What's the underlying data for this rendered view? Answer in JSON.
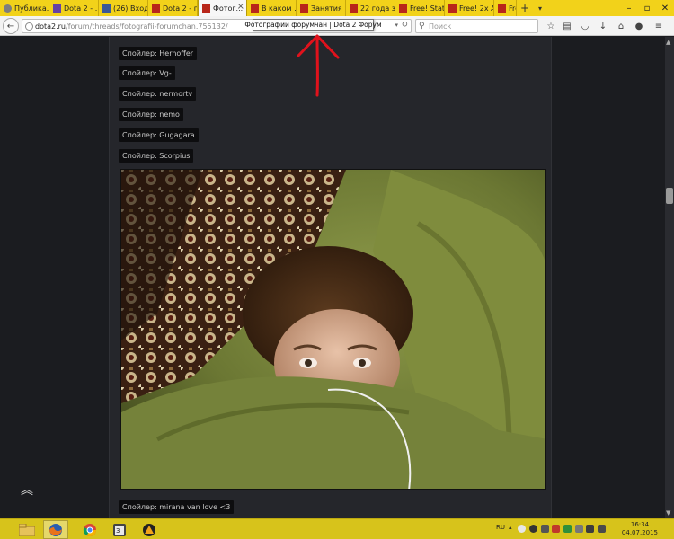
{
  "browser": {
    "tabs": [
      {
        "label": "Публика...",
        "icon": "globe-icon"
      },
      {
        "label": "Dota 2 - ...",
        "icon": "twitch-icon"
      },
      {
        "label": "(26) Вход...",
        "icon": "facebook-icon"
      },
      {
        "label": "Dota 2 - г...",
        "icon": "dota2-icon"
      },
      {
        "label": "Фотог...",
        "icon": "dota2-icon",
        "active": true
      },
      {
        "label": "В каком ...",
        "icon": "dota2-icon"
      },
      {
        "label": "Занятия ...",
        "icon": "dota2-icon"
      },
      {
        "label": "22 года з...",
        "icon": "dota2-icon"
      },
      {
        "label": "Free! Stat...",
        "icon": "dota2-icon"
      },
      {
        "label": "Free! 2x A...",
        "icon": "dota2-icon"
      },
      {
        "label": "Free",
        "icon": "dota2-icon"
      }
    ],
    "url_host": "dota2.ru",
    "url_path": "/forum/threads/fotografii-forumchan.755132/",
    "search_placeholder": "Поиск",
    "tooltip": "Фотографии форумчан | Dota 2 Форум"
  },
  "thread": {
    "spoilers": [
      "Спойлер: Herhoffer",
      "Спойлер: Vg-",
      "Спойлер: nermortv",
      "Спойлер: nemo",
      "Спойлер: Gugagara",
      "Спойлер: Scorpius"
    ],
    "spoiler_after_photo": "Спойлер: mirana van love <3"
  },
  "taskbar": {
    "language": "RU",
    "time": "16:34",
    "date": "04.07.2015"
  },
  "colors": {
    "tab_bar": "#f2d21a",
    "page_bg": "#1b1c20",
    "post_column": "#25262b",
    "spoiler_bg": "#0d0d0f",
    "annotation": "#e0121c",
    "taskbar": "#d7c31b"
  }
}
